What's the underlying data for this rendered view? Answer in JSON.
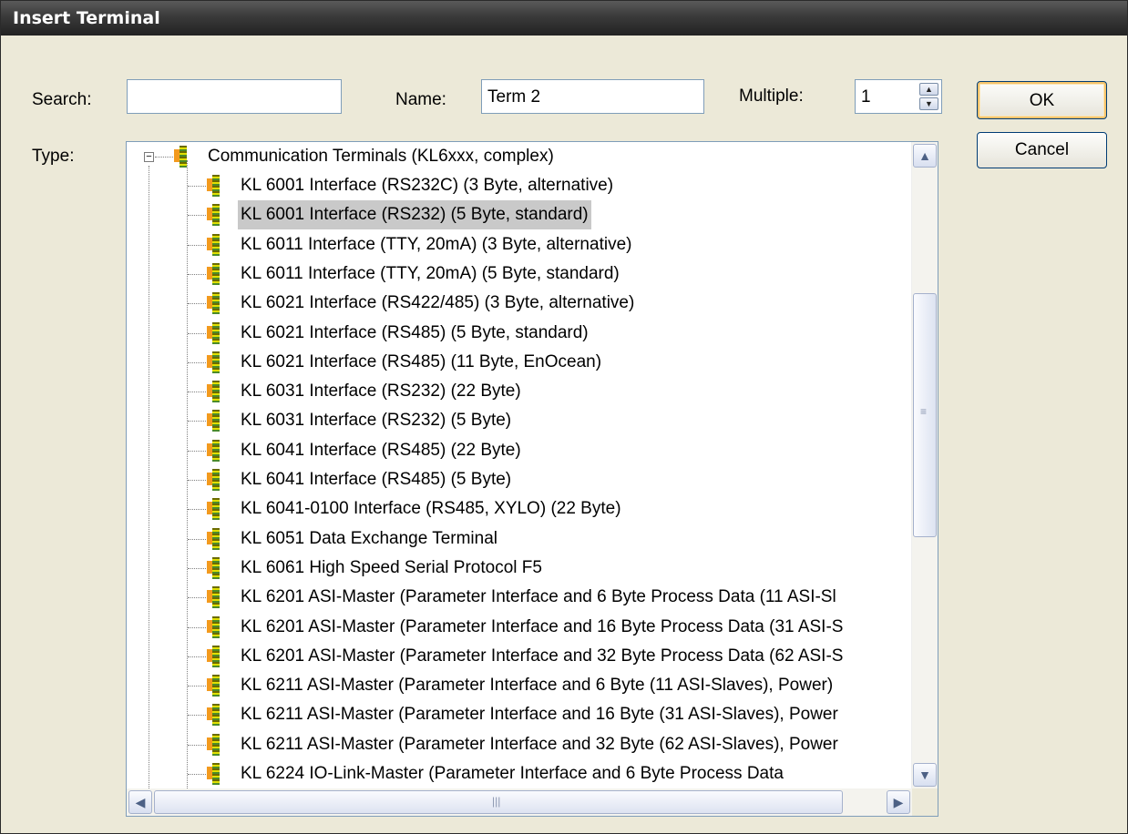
{
  "window": {
    "title": "Insert Terminal"
  },
  "search": {
    "label": "Search:",
    "value": ""
  },
  "name": {
    "label": "Name:",
    "value": "Term 2"
  },
  "multiple": {
    "label": "Multiple:",
    "value": "1"
  },
  "type": {
    "label": "Type:"
  },
  "buttons": {
    "ok": "OK",
    "cancel": "Cancel"
  },
  "tree": {
    "root": "Communication Terminals (KL6xxx, complex)",
    "selected_index": 1,
    "items": [
      "KL 6001 Interface (RS232C) (3 Byte, alternative)",
      "KL 6001 Interface (RS232) (5 Byte, standard)",
      "KL 6011 Interface (TTY, 20mA) (3 Byte, alternative)",
      "KL 6011 Interface (TTY, 20mA) (5 Byte, standard)",
      "KL 6021 Interface (RS422/485) (3 Byte, alternative)",
      "KL 6021 Interface (RS485) (5 Byte, standard)",
      "KL 6021 Interface (RS485) (11 Byte, EnOcean)",
      "KL 6031 Interface (RS232) (22 Byte)",
      "KL 6031 Interface (RS232) (5 Byte)",
      "KL 6041 Interface (RS485) (22 Byte)",
      "KL 6041 Interface (RS485) (5 Byte)",
      "KL 6041-0100 Interface (RS485, XYLO) (22 Byte)",
      "KL 6051 Data Exchange Terminal",
      "KL 6061 High Speed Serial Protocol F5",
      "KL 6201 ASI-Master (Parameter Interface and 6 Byte Process Data (11 ASI-Sl",
      "KL 6201 ASI-Master (Parameter Interface and 16 Byte Process Data (31 ASI-S",
      "KL 6201 ASI-Master (Parameter Interface and 32 Byte Process Data (62 ASI-S",
      "KL 6211 ASI-Master (Parameter Interface and 6 Byte (11 ASI-Slaves), Power)",
      "KL 6211 ASI-Master (Parameter Interface and 16 Byte (31 ASI-Slaves), Power",
      "KL 6211 ASI-Master (Parameter Interface and 32 Byte (62 ASI-Slaves), Power",
      "KL 6224 IO-Link-Master (Parameter Interface and 6 Byte Process Data"
    ]
  }
}
